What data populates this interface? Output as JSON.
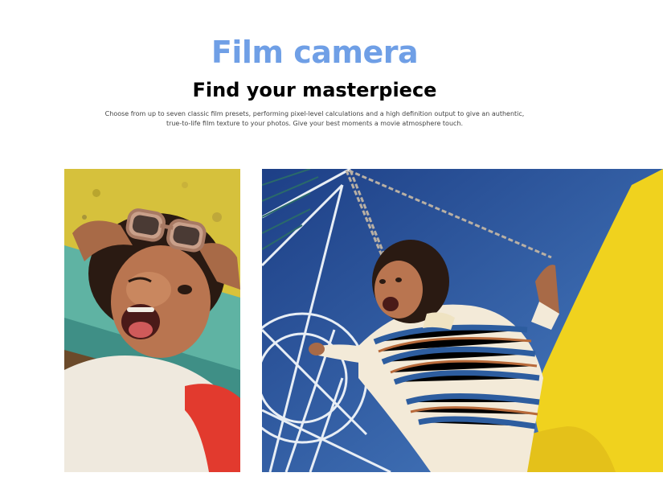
{
  "section": {
    "title": "Film camera",
    "subtitle": "Find your masterpiece",
    "description": "Choose from up to seven classic film presets, performing pixel-level calculations and a high definition output to give an authentic, true-to-life film texture to your photos. Give your best moments a movie atmosphere touch."
  },
  "colors": {
    "title_accent": "#6f9fe6",
    "subtitle": "#000000",
    "body_text": "#444444",
    "background": "#ffffff"
  }
}
